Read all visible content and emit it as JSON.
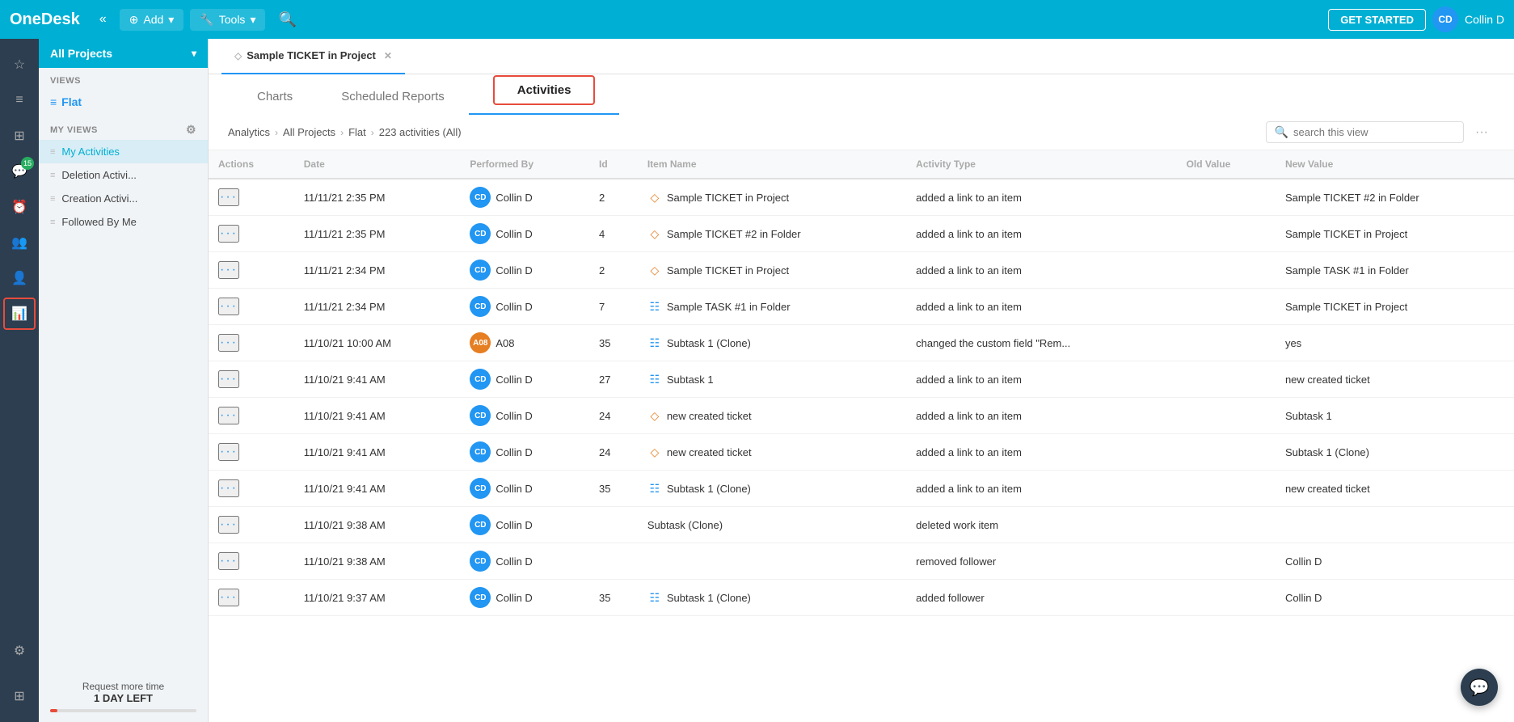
{
  "header": {
    "logo": "OneDesk",
    "collapse_icon": "«",
    "add_label": "Add",
    "tools_label": "Tools",
    "get_started_label": "GET STARTED",
    "user_initials": "CD",
    "username": "Collin D"
  },
  "sidebar_icons": [
    {
      "id": "star-icon",
      "symbol": "☆",
      "tooltip": "Favorites",
      "active": false
    },
    {
      "id": "list-icon",
      "symbol": "≡",
      "tooltip": "List",
      "active": false
    },
    {
      "id": "card-icon",
      "symbol": "⊞",
      "tooltip": "Cards",
      "active": false
    },
    {
      "id": "chat-sidebar-icon",
      "symbol": "💬",
      "tooltip": "Messages",
      "active": false,
      "badge": "15"
    },
    {
      "id": "clock-icon",
      "symbol": "⏰",
      "tooltip": "Timer",
      "active": false
    },
    {
      "id": "team-icon",
      "symbol": "👥",
      "tooltip": "Team",
      "active": false
    },
    {
      "id": "customers-icon",
      "symbol": "👤",
      "tooltip": "Customers",
      "active": false
    },
    {
      "id": "analytics-icon",
      "symbol": "📊",
      "tooltip": "Analytics",
      "active": true
    },
    {
      "id": "settings-icon",
      "symbol": "⚙",
      "tooltip": "Settings",
      "active": false
    },
    {
      "id": "grid-icon",
      "symbol": "⊞",
      "tooltip": "Apps",
      "active": false
    }
  ],
  "left_panel": {
    "all_projects_label": "All Projects",
    "views_label": "VIEWS",
    "flat_label": "Flat",
    "my_views_label": "MY VIEWS",
    "nav_items": [
      {
        "id": "my-activities",
        "label": "My Activities",
        "active": true
      },
      {
        "id": "deletion-activi",
        "label": "Deletion Activi..."
      },
      {
        "id": "creation-activi",
        "label": "Creation Activi..."
      },
      {
        "id": "followed-by-me",
        "label": "Followed By Me"
      }
    ],
    "footer": {
      "request_label": "Request more time",
      "time_left": "1 DAY LEFT"
    }
  },
  "tabs": [
    {
      "id": "sample-ticket-tab",
      "label": "Sample TICKET in Project",
      "icon": "◇",
      "active": true,
      "closable": true
    }
  ],
  "sub_tabs": [
    {
      "id": "charts-tab",
      "label": "Charts"
    },
    {
      "id": "scheduled-reports-tab",
      "label": "Scheduled Reports"
    },
    {
      "id": "activities-tab",
      "label": "Activities",
      "active": true
    }
  ],
  "breadcrumb": {
    "items": [
      {
        "id": "analytics-crumb",
        "label": "Analytics"
      },
      {
        "id": "all-projects-crumb",
        "label": "All Projects"
      },
      {
        "id": "flat-crumb",
        "label": "Flat"
      },
      {
        "id": "count-crumb",
        "label": "223 activities (All)"
      }
    ]
  },
  "search": {
    "placeholder": "search this view"
  },
  "table": {
    "columns": [
      {
        "id": "actions-col",
        "label": "Actions"
      },
      {
        "id": "date-col",
        "label": "Date"
      },
      {
        "id": "performed-by-col",
        "label": "Performed By"
      },
      {
        "id": "id-col",
        "label": "Id"
      },
      {
        "id": "item-name-col",
        "label": "Item Name"
      },
      {
        "id": "activity-type-col",
        "label": "Activity Type"
      },
      {
        "id": "old-value-col",
        "label": "Old Value"
      },
      {
        "id": "new-value-col",
        "label": "New Value"
      }
    ],
    "rows": [
      {
        "actions": "···",
        "date": "11/11/21 2:35 PM",
        "performer_initials": "CD",
        "performer_name": "Collin D",
        "id": "2",
        "item_type": "ticket",
        "item_name": "Sample TICKET in Project",
        "activity_type": "added a link to an item",
        "old_value": "",
        "new_value": "Sample TICKET #2 in Folder"
      },
      {
        "actions": "···",
        "date": "11/11/21 2:35 PM",
        "performer_initials": "CD",
        "performer_name": "Collin D",
        "id": "4",
        "item_type": "ticket",
        "item_name": "Sample TICKET #2 in Folder",
        "activity_type": "added a link to an item",
        "old_value": "",
        "new_value": "Sample TICKET in Project"
      },
      {
        "actions": "···",
        "date": "11/11/21 2:34 PM",
        "performer_initials": "CD",
        "performer_name": "Collin D",
        "id": "2",
        "item_type": "ticket",
        "item_name": "Sample TICKET in Project",
        "activity_type": "added a link to an item",
        "old_value": "",
        "new_value": "Sample TASK #1 in Folder"
      },
      {
        "actions": "···",
        "date": "11/11/21 2:34 PM",
        "performer_initials": "CD",
        "performer_name": "Collin D",
        "id": "7",
        "item_type": "task",
        "item_name": "Sample TASK #1 in Folder",
        "activity_type": "added a link to an item",
        "old_value": "",
        "new_value": "Sample TICKET in Project"
      },
      {
        "actions": "···",
        "date": "11/10/21 10:00 AM",
        "performer_initials": "A08",
        "performer_name": "A08",
        "performer_color": "orange",
        "id": "35",
        "item_type": "task",
        "item_name": "Subtask 1 (Clone)",
        "activity_type": "changed the custom field \"Rem...",
        "old_value": "",
        "new_value": "yes"
      },
      {
        "actions": "···",
        "date": "11/10/21 9:41 AM",
        "performer_initials": "CD",
        "performer_name": "Collin D",
        "id": "27",
        "item_type": "task",
        "item_name": "Subtask 1",
        "activity_type": "added a link to an item",
        "old_value": "",
        "new_value": "new created ticket"
      },
      {
        "actions": "···",
        "date": "11/10/21 9:41 AM",
        "performer_initials": "CD",
        "performer_name": "Collin D",
        "id": "24",
        "item_type": "ticket",
        "item_name": "new created ticket",
        "activity_type": "added a link to an item",
        "old_value": "",
        "new_value": "Subtask 1"
      },
      {
        "actions": "···",
        "date": "11/10/21 9:41 AM",
        "performer_initials": "CD",
        "performer_name": "Collin D",
        "id": "24",
        "item_type": "ticket",
        "item_name": "new created ticket",
        "activity_type": "added a link to an item",
        "old_value": "",
        "new_value": "Subtask 1 (Clone)"
      },
      {
        "actions": "···",
        "date": "11/10/21 9:41 AM",
        "performer_initials": "CD",
        "performer_name": "Collin D",
        "id": "35",
        "item_type": "task",
        "item_name": "Subtask 1 (Clone)",
        "activity_type": "added a link to an item",
        "old_value": "",
        "new_value": "new created ticket"
      },
      {
        "actions": "···",
        "date": "11/10/21 9:38 AM",
        "performer_initials": "CD",
        "performer_name": "Collin D",
        "id": "",
        "item_type": "none",
        "item_name": "Subtask (Clone)",
        "activity_type": "deleted work item",
        "old_value": "",
        "new_value": ""
      },
      {
        "actions": "···",
        "date": "11/10/21 9:38 AM",
        "performer_initials": "CD",
        "performer_name": "Collin D",
        "id": "",
        "item_type": "none",
        "item_name": "",
        "activity_type": "removed follower",
        "old_value": "",
        "new_value": "Collin D"
      },
      {
        "actions": "···",
        "date": "11/10/21 9:37 AM",
        "performer_initials": "CD",
        "performer_name": "Collin D",
        "id": "35",
        "item_type": "task",
        "item_name": "Subtask 1 (Clone)",
        "activity_type": "added follower",
        "old_value": "",
        "new_value": "Collin D"
      }
    ]
  }
}
